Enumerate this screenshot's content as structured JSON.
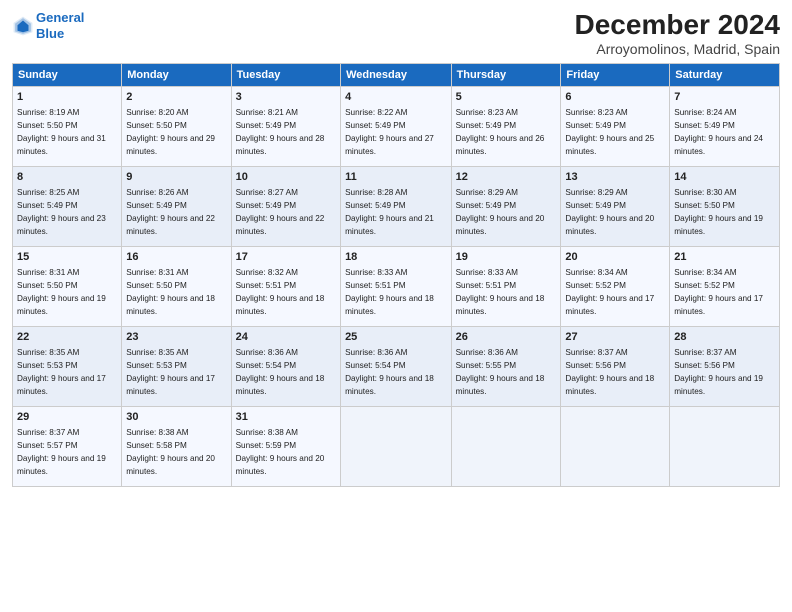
{
  "logo": {
    "line1": "General",
    "line2": "Blue"
  },
  "title": "December 2024",
  "location": "Arroyomolinos, Madrid, Spain",
  "days_of_week": [
    "Sunday",
    "Monday",
    "Tuesday",
    "Wednesday",
    "Thursday",
    "Friday",
    "Saturday"
  ],
  "weeks": [
    [
      {
        "day": "1",
        "sunrise": "Sunrise: 8:19 AM",
        "sunset": "Sunset: 5:50 PM",
        "daylight": "Daylight: 9 hours and 31 minutes."
      },
      {
        "day": "2",
        "sunrise": "Sunrise: 8:20 AM",
        "sunset": "Sunset: 5:50 PM",
        "daylight": "Daylight: 9 hours and 29 minutes."
      },
      {
        "day": "3",
        "sunrise": "Sunrise: 8:21 AM",
        "sunset": "Sunset: 5:49 PM",
        "daylight": "Daylight: 9 hours and 28 minutes."
      },
      {
        "day": "4",
        "sunrise": "Sunrise: 8:22 AM",
        "sunset": "Sunset: 5:49 PM",
        "daylight": "Daylight: 9 hours and 27 minutes."
      },
      {
        "day": "5",
        "sunrise": "Sunrise: 8:23 AM",
        "sunset": "Sunset: 5:49 PM",
        "daylight": "Daylight: 9 hours and 26 minutes."
      },
      {
        "day": "6",
        "sunrise": "Sunrise: 8:23 AM",
        "sunset": "Sunset: 5:49 PM",
        "daylight": "Daylight: 9 hours and 25 minutes."
      },
      {
        "day": "7",
        "sunrise": "Sunrise: 8:24 AM",
        "sunset": "Sunset: 5:49 PM",
        "daylight": "Daylight: 9 hours and 24 minutes."
      }
    ],
    [
      {
        "day": "8",
        "sunrise": "Sunrise: 8:25 AM",
        "sunset": "Sunset: 5:49 PM",
        "daylight": "Daylight: 9 hours and 23 minutes."
      },
      {
        "day": "9",
        "sunrise": "Sunrise: 8:26 AM",
        "sunset": "Sunset: 5:49 PM",
        "daylight": "Daylight: 9 hours and 22 minutes."
      },
      {
        "day": "10",
        "sunrise": "Sunrise: 8:27 AM",
        "sunset": "Sunset: 5:49 PM",
        "daylight": "Daylight: 9 hours and 22 minutes."
      },
      {
        "day": "11",
        "sunrise": "Sunrise: 8:28 AM",
        "sunset": "Sunset: 5:49 PM",
        "daylight": "Daylight: 9 hours and 21 minutes."
      },
      {
        "day": "12",
        "sunrise": "Sunrise: 8:29 AM",
        "sunset": "Sunset: 5:49 PM",
        "daylight": "Daylight: 9 hours and 20 minutes."
      },
      {
        "day": "13",
        "sunrise": "Sunrise: 8:29 AM",
        "sunset": "Sunset: 5:49 PM",
        "daylight": "Daylight: 9 hours and 20 minutes."
      },
      {
        "day": "14",
        "sunrise": "Sunrise: 8:30 AM",
        "sunset": "Sunset: 5:50 PM",
        "daylight": "Daylight: 9 hours and 19 minutes."
      }
    ],
    [
      {
        "day": "15",
        "sunrise": "Sunrise: 8:31 AM",
        "sunset": "Sunset: 5:50 PM",
        "daylight": "Daylight: 9 hours and 19 minutes."
      },
      {
        "day": "16",
        "sunrise": "Sunrise: 8:31 AM",
        "sunset": "Sunset: 5:50 PM",
        "daylight": "Daylight: 9 hours and 18 minutes."
      },
      {
        "day": "17",
        "sunrise": "Sunrise: 8:32 AM",
        "sunset": "Sunset: 5:51 PM",
        "daylight": "Daylight: 9 hours and 18 minutes."
      },
      {
        "day": "18",
        "sunrise": "Sunrise: 8:33 AM",
        "sunset": "Sunset: 5:51 PM",
        "daylight": "Daylight: 9 hours and 18 minutes."
      },
      {
        "day": "19",
        "sunrise": "Sunrise: 8:33 AM",
        "sunset": "Sunset: 5:51 PM",
        "daylight": "Daylight: 9 hours and 18 minutes."
      },
      {
        "day": "20",
        "sunrise": "Sunrise: 8:34 AM",
        "sunset": "Sunset: 5:52 PM",
        "daylight": "Daylight: 9 hours and 17 minutes."
      },
      {
        "day": "21",
        "sunrise": "Sunrise: 8:34 AM",
        "sunset": "Sunset: 5:52 PM",
        "daylight": "Daylight: 9 hours and 17 minutes."
      }
    ],
    [
      {
        "day": "22",
        "sunrise": "Sunrise: 8:35 AM",
        "sunset": "Sunset: 5:53 PM",
        "daylight": "Daylight: 9 hours and 17 minutes."
      },
      {
        "day": "23",
        "sunrise": "Sunrise: 8:35 AM",
        "sunset": "Sunset: 5:53 PM",
        "daylight": "Daylight: 9 hours and 17 minutes."
      },
      {
        "day": "24",
        "sunrise": "Sunrise: 8:36 AM",
        "sunset": "Sunset: 5:54 PM",
        "daylight": "Daylight: 9 hours and 18 minutes."
      },
      {
        "day": "25",
        "sunrise": "Sunrise: 8:36 AM",
        "sunset": "Sunset: 5:54 PM",
        "daylight": "Daylight: 9 hours and 18 minutes."
      },
      {
        "day": "26",
        "sunrise": "Sunrise: 8:36 AM",
        "sunset": "Sunset: 5:55 PM",
        "daylight": "Daylight: 9 hours and 18 minutes."
      },
      {
        "day": "27",
        "sunrise": "Sunrise: 8:37 AM",
        "sunset": "Sunset: 5:56 PM",
        "daylight": "Daylight: 9 hours and 18 minutes."
      },
      {
        "day": "28",
        "sunrise": "Sunrise: 8:37 AM",
        "sunset": "Sunset: 5:56 PM",
        "daylight": "Daylight: 9 hours and 19 minutes."
      }
    ],
    [
      {
        "day": "29",
        "sunrise": "Sunrise: 8:37 AM",
        "sunset": "Sunset: 5:57 PM",
        "daylight": "Daylight: 9 hours and 19 minutes."
      },
      {
        "day": "30",
        "sunrise": "Sunrise: 8:38 AM",
        "sunset": "Sunset: 5:58 PM",
        "daylight": "Daylight: 9 hours and 20 minutes."
      },
      {
        "day": "31",
        "sunrise": "Sunrise: 8:38 AM",
        "sunset": "Sunset: 5:59 PM",
        "daylight": "Daylight: 9 hours and 20 minutes."
      },
      null,
      null,
      null,
      null
    ]
  ]
}
